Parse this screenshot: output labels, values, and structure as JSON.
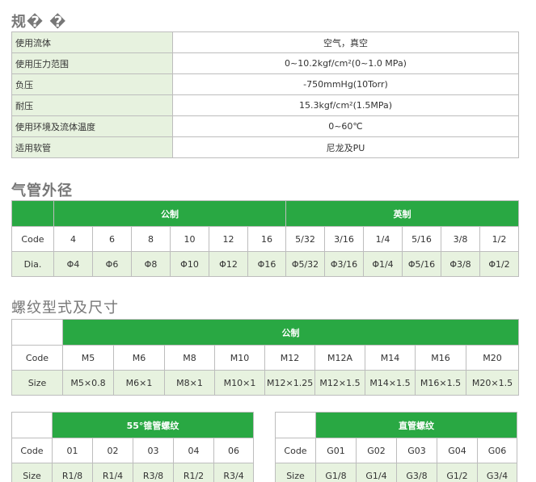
{
  "spec": {
    "title": "规� �",
    "rows": [
      {
        "label": "使用流体",
        "value": "空气，真空"
      },
      {
        "label": "使用压力范围",
        "value": "0~10.2kgf/cm²(0~1.0 MPa)"
      },
      {
        "label": "负压",
        "value": "-750mmHg(10Torr)"
      },
      {
        "label": "耐压",
        "value": "15.3kgf/cm²(1.5MPa)"
      },
      {
        "label": "使用环境及流体温度",
        "value": "0~60℃"
      },
      {
        "label": "适用软管",
        "value": "尼龙及PU"
      }
    ]
  },
  "tube": {
    "title": "气管外径",
    "metric": "公制",
    "inch": "英制",
    "code_label": "Code",
    "dia_label": "Dia.",
    "codes": [
      "4",
      "6",
      "8",
      "10",
      "12",
      "16",
      "5/32",
      "3/16",
      "1/4",
      "5/16",
      "3/8",
      "1/2"
    ],
    "dias": [
      "Φ4",
      "Φ6",
      "Φ8",
      "Φ10",
      "Φ12",
      "Φ16",
      "Φ5/32",
      "Φ3/16",
      "Φ1/4",
      "Φ5/16",
      "Φ3/8",
      "Φ1/2"
    ]
  },
  "thread": {
    "title": "螺纹型式及尺寸",
    "metric": "公制",
    "code_label": "Code",
    "size_label": "Size",
    "codes": [
      "M5",
      "M6",
      "M8",
      "M10",
      "M12",
      "M12A",
      "M14",
      "M16",
      "M20"
    ],
    "sizes": [
      "M5×0.8",
      "M6×1",
      "M8×1",
      "M10×1",
      "M12×1.25",
      "M12×1.5",
      "M14×1.5",
      "M16×1.5",
      "M20×1.5"
    ]
  },
  "taper": {
    "title": "55°锥管螺纹",
    "code_label": "Code",
    "size_label": "Size",
    "codes": [
      "01",
      "02",
      "03",
      "04",
      "06"
    ],
    "sizes": [
      "R1/8",
      "R1/4",
      "R3/8",
      "R1/2",
      "R3/4"
    ]
  },
  "straight": {
    "title": "直管螺纹",
    "code_label": "Code",
    "size_label": "Size",
    "codes": [
      "G01",
      "G02",
      "G03",
      "G04",
      "G06"
    ],
    "sizes": [
      "G1/8",
      "G1/4",
      "G3/8",
      "G1/2",
      "G3/4"
    ]
  }
}
